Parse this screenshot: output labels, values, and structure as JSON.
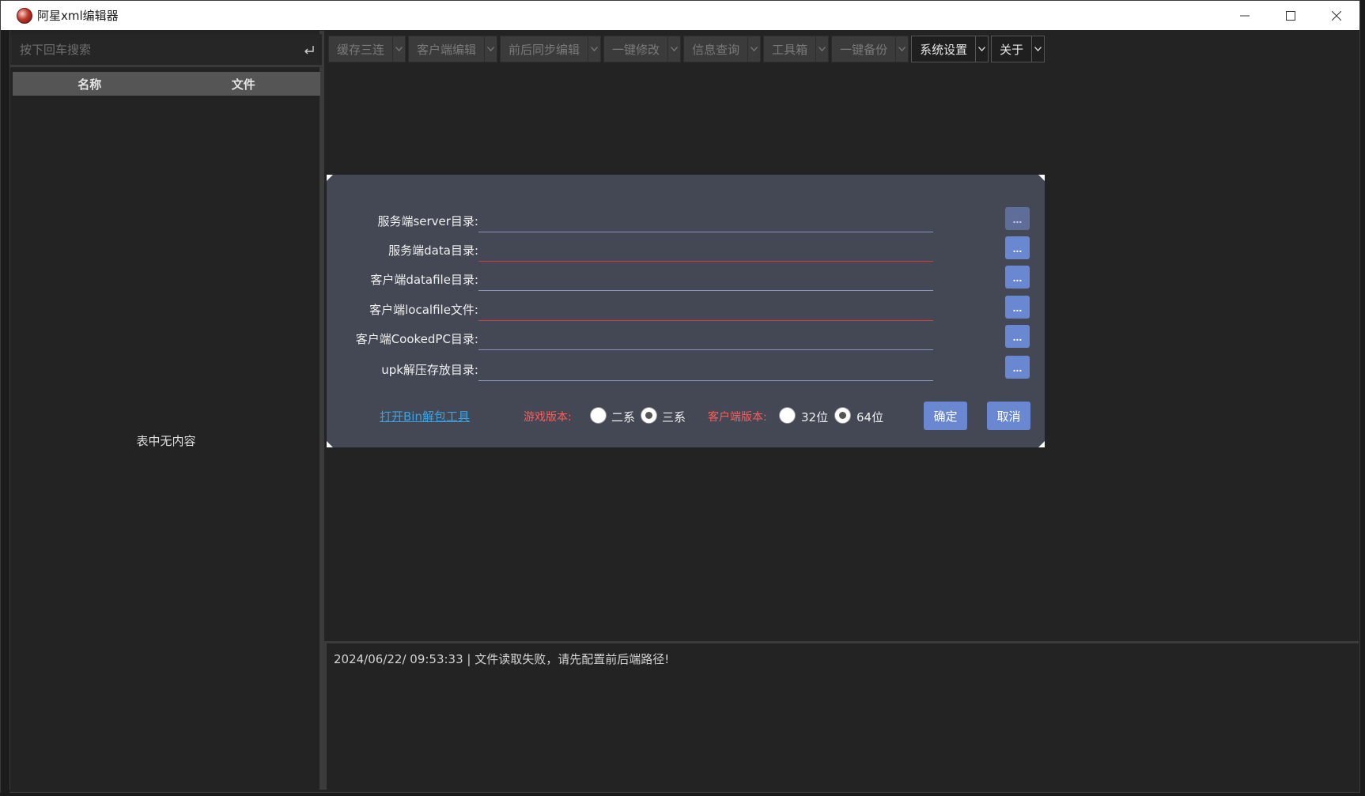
{
  "window": {
    "title": "阿星xml编辑器"
  },
  "sidebar": {
    "search_placeholder": "按下回车搜索",
    "columns": [
      "名称",
      "文件"
    ],
    "empty_text": "表中无内容"
  },
  "toolbar": {
    "items": [
      {
        "label": "缓存三连",
        "enabled": false
      },
      {
        "label": "客户端编辑",
        "enabled": false
      },
      {
        "label": "前后同步编辑",
        "enabled": false
      },
      {
        "label": "一键修改",
        "enabled": false
      },
      {
        "label": "信息查询",
        "enabled": false
      },
      {
        "label": "工具箱",
        "enabled": false
      },
      {
        "label": "一键备份",
        "enabled": false
      },
      {
        "label": "系统设置",
        "enabled": true
      },
      {
        "label": "关于",
        "enabled": true
      }
    ]
  },
  "dialog": {
    "fields": [
      {
        "label": "服务端server目录:",
        "value": "",
        "error": false,
        "browse": "..."
      },
      {
        "label": "服务端data目录:",
        "value": "",
        "error": true,
        "browse": "..."
      },
      {
        "label": "客户端datafile目录:",
        "value": "",
        "error": false,
        "browse": "..."
      },
      {
        "label": "客户端localfile文件:",
        "value": "",
        "error": true,
        "browse": "..."
      },
      {
        "label": "客户端CookedPC目录:",
        "value": "",
        "error": false,
        "browse": "..."
      },
      {
        "label": "upk解压存放目录:",
        "value": "",
        "error": false,
        "browse": "..."
      }
    ],
    "open_bin_link": "打开Bin解包工具",
    "game_version_label": "游戏版本:",
    "game_version_options": [
      "二系",
      "三系"
    ],
    "game_version_selected": "三系",
    "client_version_label": "客户端版本:",
    "client_version_options": [
      "32位",
      "64位"
    ],
    "client_version_selected": "64位",
    "confirm_label": "确定",
    "cancel_label": "取消"
  },
  "log": {
    "lines": [
      "2024/06/22/ 09:53:33 | 文件读取失败，请先配置前后端路径!"
    ]
  },
  "colors": {
    "background": "#232323",
    "dialog_bg": "#434854",
    "accent": "#6a88d2",
    "error_red": "#d83a3a",
    "link": "#3aa3e3"
  }
}
